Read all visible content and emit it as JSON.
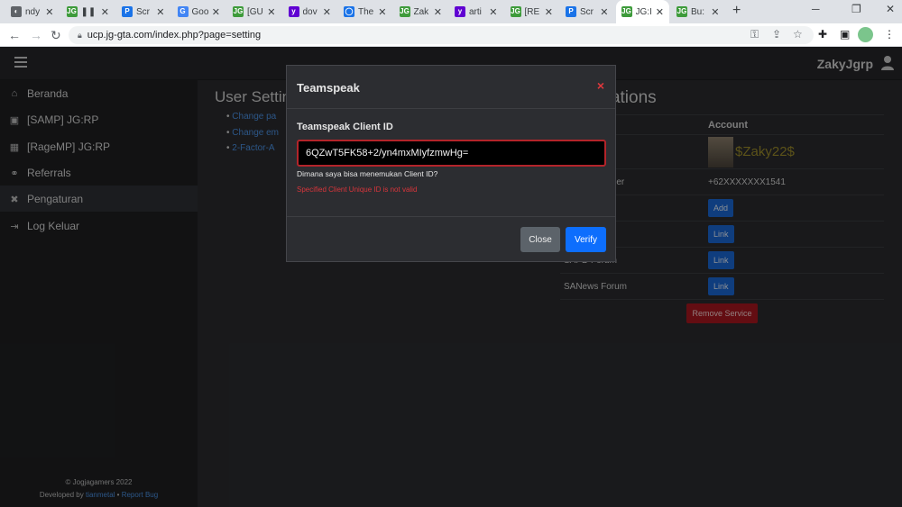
{
  "browser": {
    "tabs": [
      {
        "label": "ndy",
        "color": "#5f6368",
        "glyph": "◐"
      },
      {
        "label": "❚❚ [g",
        "color": "#3e9b3b",
        "glyph": "JG"
      },
      {
        "label": "Scr",
        "color": "#1a73e8",
        "glyph": "P"
      },
      {
        "label": "Goo",
        "color": "#4285f4",
        "glyph": "G"
      },
      {
        "label": "[GU",
        "color": "#3e9b3b",
        "glyph": "JG"
      },
      {
        "label": "dov",
        "color": "#6001d2",
        "glyph": "y"
      },
      {
        "label": "The",
        "color": "#1a73e8",
        "glyph": "◯"
      },
      {
        "label": "Zak",
        "color": "#3e9b3b",
        "glyph": "JG"
      },
      {
        "label": "arti",
        "color": "#6001d2",
        "glyph": "y"
      },
      {
        "label": "[RE",
        "color": "#3e9b3b",
        "glyph": "JG"
      },
      {
        "label": "Scr",
        "color": "#1a73e8",
        "glyph": "P"
      },
      {
        "label": "JG:I",
        "color": "#3e9b3b",
        "glyph": "JG"
      },
      {
        "label": "Bu:",
        "color": "#3e9b3b",
        "glyph": "JG"
      }
    ],
    "url": "ucp.jg-gta.com/index.php?page=setting"
  },
  "header": {
    "username": "ZakyJgrp"
  },
  "sidebar": {
    "items": [
      {
        "label": "Beranda",
        "icon": "home-icon",
        "glyph": "⌂"
      },
      {
        "label": "[SAMP] JG:RP",
        "icon": "samp-icon",
        "glyph": "▣"
      },
      {
        "label": "[RageMP] JG:RP",
        "icon": "ragemp-icon",
        "glyph": "▦"
      },
      {
        "label": "Referrals",
        "icon": "handshake-icon",
        "glyph": "⚭"
      },
      {
        "label": "Pengaturan",
        "icon": "tools-icon",
        "glyph": "✖"
      },
      {
        "label": "Log Keluar",
        "icon": "logout-icon",
        "glyph": "⇥"
      }
    ],
    "footer": {
      "copyright": "© Jogjagamers 2022",
      "developed_prefix": "Developed by ",
      "developer": "tianmetal",
      "sep": " • ",
      "report": "Report Bug"
    }
  },
  "user_settings": {
    "title": "User Settings",
    "links": [
      "Change pa",
      "Change em",
      "2-Factor-A"
    ]
  },
  "associations": {
    "title": "Associations",
    "col_account": "Account",
    "avatar_name": "$Zaky22$",
    "rows": [
      {
        "label": "Phone Number",
        "value": "+62XXXXXXX1541"
      },
      {
        "label": "",
        "button": "Add"
      },
      {
        "label": "Discord",
        "button": "Link"
      },
      {
        "label": "SAPD Forum",
        "button": "Link"
      },
      {
        "label": "SANews Forum",
        "button": "Link"
      }
    ],
    "remove_button": "Remove Service"
  },
  "modal": {
    "title": "Teamspeak",
    "close_glyph": "×",
    "field_label": "Teamspeak Client ID",
    "field_value": "6QZwT5FK58+2/yn4mxMIyfzmwHg=",
    "help_text": "Dimana saya bisa menemukan Client ID?",
    "error_text": "Specified Client Unique ID is not valid",
    "close_label": "Close",
    "verify_label": "Verify"
  }
}
